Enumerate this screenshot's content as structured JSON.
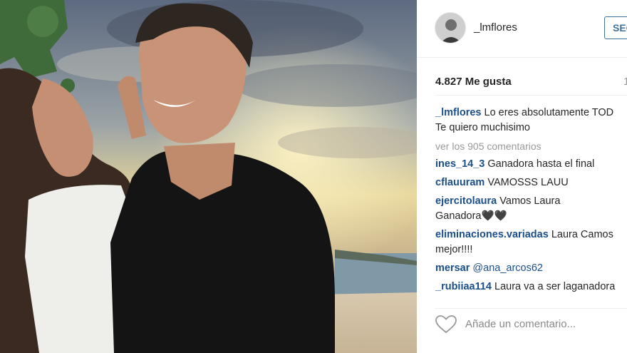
{
  "header": {
    "username": "_lmflores",
    "follow_label": "SEGUIR"
  },
  "likes": {
    "count_label": "4.827 Me gusta",
    "extra": "1"
  },
  "caption": {
    "user": "_lmflores",
    "text": "Lo eres absolutamente TOD",
    "text2": "Te quiero muchisimo"
  },
  "view_all": "ver los 905 comentarios",
  "comments": [
    {
      "user": "ines_14_3",
      "text": "Ganadora hasta el final"
    },
    {
      "user": "cflauuram",
      "text": "VAMOSSS LAUU"
    },
    {
      "user": "ejercitolaura",
      "text": "Vamos Laura",
      "text2": "Ganadora🖤🖤"
    },
    {
      "user": "eliminaciones.variadas",
      "text": "Laura Camos",
      "text2": "mejor!!!!"
    },
    {
      "user": "mersar",
      "text": "@ana_arcos62"
    },
    {
      "user": "_rubiiaa114",
      "text": "Laura va a ser laganadora"
    }
  ],
  "add_comment": {
    "placeholder": "Añade un comentario..."
  },
  "colors": {
    "username_link": "#1b4f8a",
    "follow_border": "#3f729b",
    "muted": "#999999"
  },
  "icons": {
    "like": "heart-outline-icon"
  }
}
